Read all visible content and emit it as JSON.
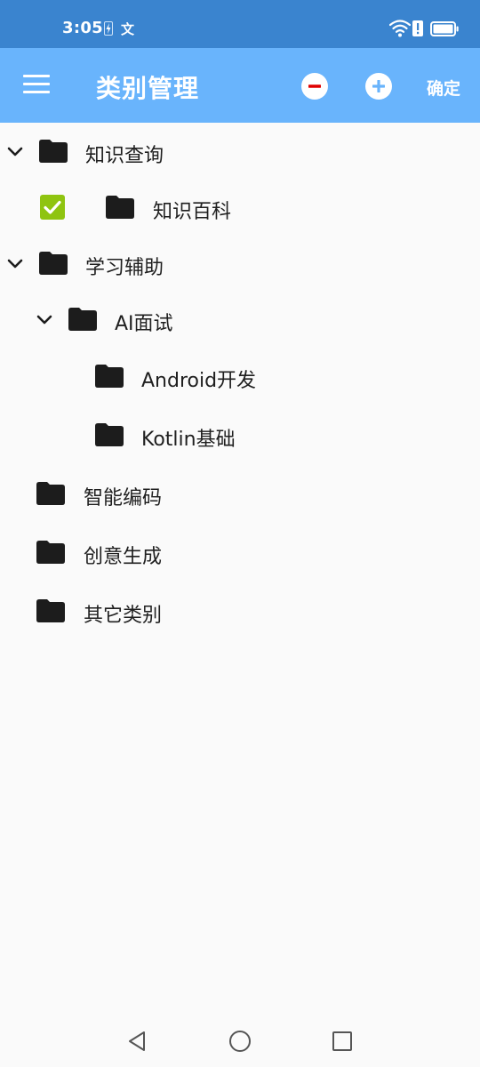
{
  "status_bar": {
    "time": "3:05",
    "lang_glyph": "文",
    "icons": [
      "charging-icon",
      "translate-icon",
      "wifi-icon",
      "alert-icon",
      "battery-icon"
    ]
  },
  "app_bar": {
    "title": "类别管理",
    "confirm_label": "确定",
    "icons": [
      "menu-icon",
      "remove-circle-icon",
      "add-circle-icon"
    ],
    "background": "#69b4fc",
    "minus_color": "#e00000",
    "plus_color": "#69b4fc"
  },
  "tree": {
    "items": [
      {
        "label": "知识查询",
        "expanded": true
      },
      {
        "label": "知识百科",
        "checked": true
      },
      {
        "label": "学习辅助",
        "expanded": true
      },
      {
        "label": "AI面试",
        "expanded": true
      },
      {
        "label": "Android开发"
      },
      {
        "label": "Kotlin基础"
      },
      {
        "label": "智能编码"
      },
      {
        "label": "创意生成"
      },
      {
        "label": "其它类别"
      }
    ],
    "checkbox_color": "#8fc410",
    "folder_color": "#1c1c1c"
  },
  "nav_bar": {
    "icons": [
      "back-icon",
      "home-icon",
      "recents-icon"
    ]
  }
}
